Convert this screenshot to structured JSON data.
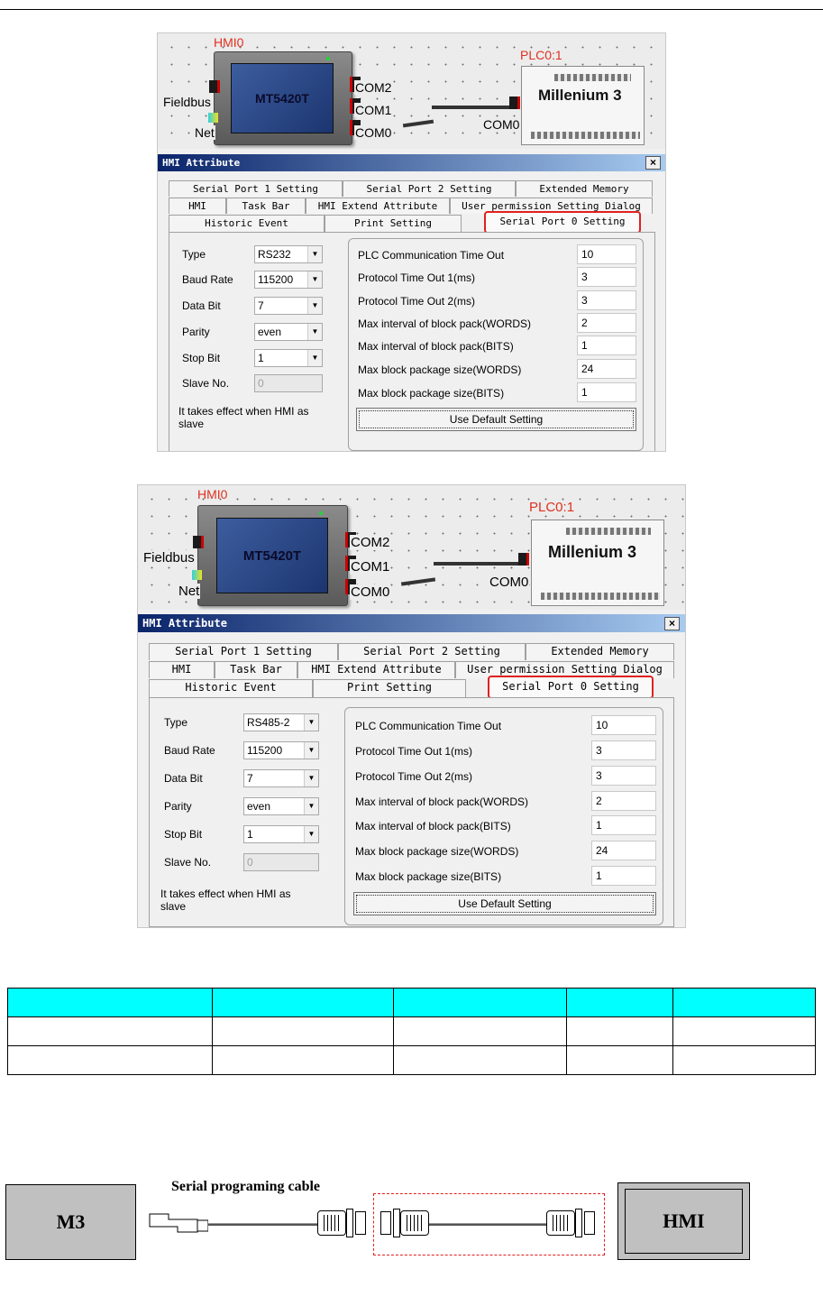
{
  "screenshots": [
    {
      "canvas": {
        "hmi_label": "HMI0",
        "hmi_model": "MT5420T",
        "plc_label": "PLC0:1",
        "plc_name": "Millenium 3",
        "ports": [
          "COM2",
          "COM1",
          "COM0"
        ],
        "plc_port": "COM0",
        "left_labels": [
          "Fieldbus",
          "Net"
        ]
      },
      "dialog": {
        "title": "HMI Attribute",
        "close": "×",
        "tabs_row1": [
          "Serial Port 1 Setting",
          "Serial Port 2 Setting",
          "Extended Memory"
        ],
        "tabs_row2": [
          "HMI",
          "Task Bar",
          "HMI Extend Attribute",
          "User permission Setting Dialog"
        ],
        "tabs_row3": [
          "Historic Event",
          "Print Setting",
          "Serial Port 0 Setting"
        ],
        "active_tab": "Serial Port 0 Setting",
        "fields": [
          {
            "label": "Type",
            "value": "RS232"
          },
          {
            "label": "Baud Rate",
            "value": "115200"
          },
          {
            "label": "Data Bit",
            "value": "7"
          },
          {
            "label": "Parity",
            "value": "even"
          },
          {
            "label": "Stop Bit",
            "value": "1"
          },
          {
            "label": "Slave No.",
            "value": "0"
          }
        ],
        "note": "It takes effect when HMI as slave",
        "settings": [
          {
            "label": "PLC Communication Time Out",
            "value": "10"
          },
          {
            "label": "Protocol Time Out 1(ms)",
            "value": "3"
          },
          {
            "label": "Protocol Time Out 2(ms)",
            "value": "3"
          },
          {
            "label": "Max interval of block pack(WORDS)",
            "value": "2"
          },
          {
            "label": "Max interval of block pack(BITS)",
            "value": "1"
          },
          {
            "label": "Max block package size(WORDS)",
            "value": "24"
          },
          {
            "label": "Max block package size(BITS)",
            "value": "1"
          }
        ],
        "default_button": "Use Default Setting"
      }
    },
    {
      "canvas": {
        "hmi_label": "HMI0",
        "hmi_model": "MT5420T",
        "plc_label": "PLC0:1",
        "plc_name": "Millenium 3",
        "ports": [
          "COM2",
          "COM1",
          "COM0"
        ],
        "plc_port": "COM0",
        "left_labels": [
          "Fieldbus",
          "Net"
        ]
      },
      "dialog": {
        "title": "HMI Attribute",
        "close": "×",
        "tabs_row1": [
          "Serial Port 1 Setting",
          "Serial Port 2 Setting",
          "Extended Memory"
        ],
        "tabs_row2": [
          "HMI",
          "Task Bar",
          "HMI Extend Attribute",
          "User permission Setting Dialog"
        ],
        "tabs_row3": [
          "Historic Event",
          "Print Setting",
          "Serial Port 0 Setting"
        ],
        "active_tab": "Serial Port 0 Setting",
        "fields": [
          {
            "label": "Type",
            "value": "RS485-2"
          },
          {
            "label": "Baud Rate",
            "value": "115200"
          },
          {
            "label": "Data Bit",
            "value": "7"
          },
          {
            "label": "Parity",
            "value": "even"
          },
          {
            "label": "Stop Bit",
            "value": "1"
          },
          {
            "label": "Slave No.",
            "value": "0"
          }
        ],
        "note": "It takes effect when HMI as slave",
        "settings": [
          {
            "label": "PLC Communication Time Out",
            "value": "10"
          },
          {
            "label": "Protocol Time Out 1(ms)",
            "value": "3"
          },
          {
            "label": "Protocol Time Out 2(ms)",
            "value": "3"
          },
          {
            "label": "Max interval of block pack(WORDS)",
            "value": "2"
          },
          {
            "label": "Max interval of block pack(BITS)",
            "value": "1"
          },
          {
            "label": "Max block package size(WORDS)",
            "value": "24"
          },
          {
            "label": "Max block package size(BITS)",
            "value": "1"
          }
        ],
        "default_button": "Use Default Setting"
      }
    }
  ],
  "table": {
    "header_color": "#00ffff",
    "rows": [
      [
        "",
        "",
        "",
        "",
        ""
      ],
      [
        "",
        "",
        "",
        "",
        ""
      ],
      [
        "",
        "",
        "",
        "",
        ""
      ]
    ]
  },
  "cable_diagram": {
    "left_box": "M3",
    "title": "Serial programing cable",
    "right_box": "HMI"
  }
}
